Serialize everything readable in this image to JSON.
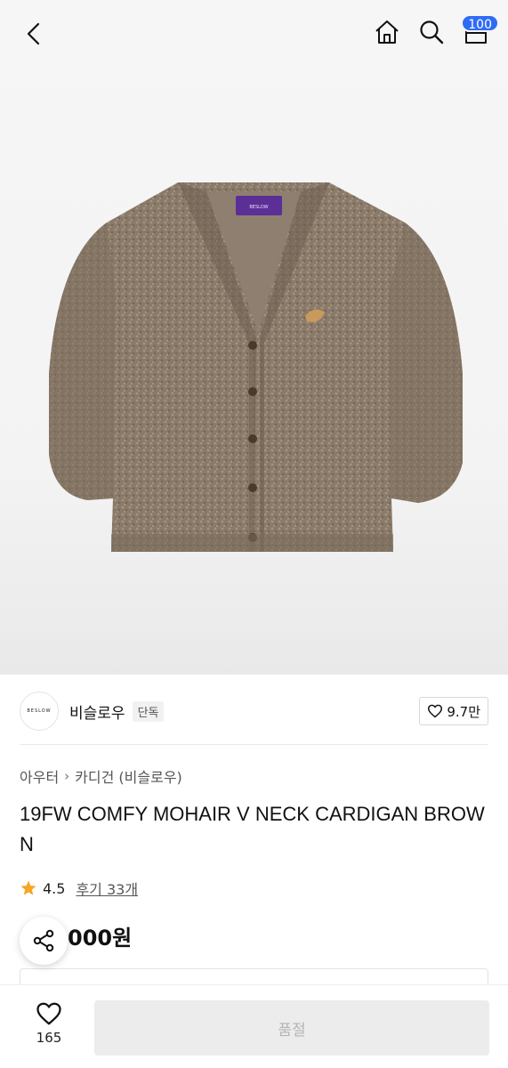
{
  "header": {
    "back_icon": "chevron-left-icon",
    "home_icon": "home-icon",
    "search_icon": "search-icon",
    "cart_icon": "cart-icon",
    "cart_count": "100",
    "badge_color": "#2f6cf6"
  },
  "hero": {
    "label_text": "BESLOW"
  },
  "brand": {
    "logo_text": "BESLOW",
    "name": "비슬로우",
    "tag": "단독",
    "likes": "9.7만"
  },
  "breadcrumb": {
    "category": "아우터",
    "subcategory": "카디건 (비슬로우)"
  },
  "product": {
    "title": "19FW COMFY MOHAIR V NECK CARDIGAN BROWN",
    "rating": "4.5",
    "reviews": "후기 33개",
    "price": "000원",
    "star_color": "#f5a623"
  },
  "bottom": {
    "wish_count": "165",
    "buy_label": "품절"
  }
}
